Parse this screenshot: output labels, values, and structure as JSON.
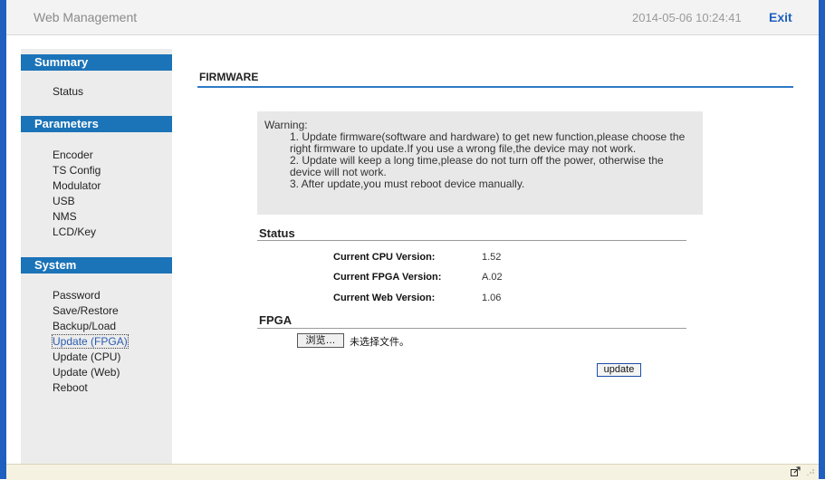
{
  "header": {
    "title": "Web Management",
    "datetime": "2014-05-06 10:24:41",
    "exit_label": "Exit"
  },
  "sidebar": {
    "summary": {
      "title": "Summary",
      "items": [
        "Status"
      ]
    },
    "parameters": {
      "title": "Parameters",
      "items": [
        "Encoder",
        "TS Config",
        "Modulator",
        "USB",
        "NMS",
        "LCD/Key"
      ]
    },
    "system": {
      "title": "System",
      "items": [
        "Password",
        "Save/Restore",
        "Backup/Load",
        "Update (FPGA)",
        "Update (CPU)",
        "Update (Web)",
        "Reboot"
      ],
      "active": "Update (FPGA)"
    }
  },
  "main": {
    "title": "FIRMWARE",
    "warning": {
      "heading": "Warning:",
      "lines": [
        "1. Update firmware(software and hardware) to get new function,please choose the right firmware to update.If you use a wrong file,the device may not work.",
        "2. Update will keep a long time,please do not turn off the power, otherwise the device will not work.",
        "3. After update,you must reboot device manually."
      ]
    },
    "status": {
      "title": "Status",
      "rows": [
        {
          "label": "Current CPU Version:",
          "value": "1.52"
        },
        {
          "label": "Current FPGA Version:",
          "value": "A.02"
        },
        {
          "label": "Current Web Version:",
          "value": "1.06"
        }
      ]
    },
    "fpga": {
      "title": "FPGA",
      "browse_label": "浏览…",
      "file_status": "未选择文件。",
      "update_label": "update"
    }
  },
  "statusbar": {
    "icons": [
      "export-icon",
      "resize-grip-icon"
    ]
  },
  "colors": {
    "frame": "#1f5fbf",
    "section_header": "#1b73b8",
    "rule": "#2d7ac6",
    "exit": "#1f5fbf"
  }
}
